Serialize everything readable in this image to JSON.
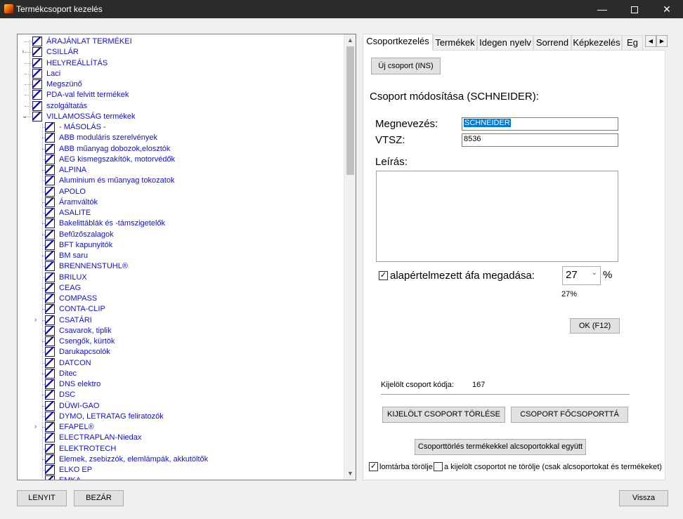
{
  "window": {
    "title": "Termékcsoport kezelés"
  },
  "tree": {
    "items": [
      {
        "label": "ÁRAJÁNLAT TERMÉKEI",
        "level": 0,
        "expander": ""
      },
      {
        "label": "CSILLÁR",
        "level": 0,
        "expander": ">"
      },
      {
        "label": "HELYREÁLLÍTÁS",
        "level": 0,
        "expander": ""
      },
      {
        "label": "Laci",
        "level": 0,
        "expander": ""
      },
      {
        "label": "Megszünő",
        "level": 0,
        "expander": ""
      },
      {
        "label": "PDA-val felvitt termékek",
        "level": 0,
        "expander": ""
      },
      {
        "label": "szolgáltatás",
        "level": 0,
        "expander": ""
      },
      {
        "label": "VILLAMOSSÁG termékek",
        "level": 0,
        "expander": "v"
      },
      {
        "label": " - MÁSOLÁS -",
        "level": 1,
        "expander": ""
      },
      {
        "label": "ABB moduláris szerelvények",
        "level": 1,
        "expander": ""
      },
      {
        "label": "ABB műanyag dobozok,elosztók",
        "level": 1,
        "expander": ""
      },
      {
        "label": "AEG kismegszakítók, motorvédők",
        "level": 1,
        "expander": ""
      },
      {
        "label": "ALPINA",
        "level": 1,
        "expander": ""
      },
      {
        "label": "Aluminium és műanyag tokozatok",
        "level": 1,
        "expander": ""
      },
      {
        "label": "APOLO",
        "level": 1,
        "expander": ""
      },
      {
        "label": "Áramváltók",
        "level": 1,
        "expander": ""
      },
      {
        "label": "ASALITE",
        "level": 1,
        "expander": ""
      },
      {
        "label": "Bakelittáblák és -támszigetelők",
        "level": 1,
        "expander": ""
      },
      {
        "label": "Befűzőszalagok",
        "level": 1,
        "expander": ""
      },
      {
        "label": "BFT kapunyitók",
        "level": 1,
        "expander": ""
      },
      {
        "label": "BM saru",
        "level": 1,
        "expander": ""
      },
      {
        "label": "BRENNENSTUHL®",
        "level": 1,
        "expander": ""
      },
      {
        "label": "BRILUX",
        "level": 1,
        "expander": ""
      },
      {
        "label": "CEAG",
        "level": 1,
        "expander": ""
      },
      {
        "label": "COMPASS",
        "level": 1,
        "expander": ""
      },
      {
        "label": "CONTA-CLIP",
        "level": 1,
        "expander": ""
      },
      {
        "label": "CSATÁRI",
        "level": 1,
        "expander": ">"
      },
      {
        "label": "Csavarok, tiplik",
        "level": 1,
        "expander": ""
      },
      {
        "label": "Csengők, kürtök",
        "level": 1,
        "expander": ""
      },
      {
        "label": "Darukapcsolók",
        "level": 1,
        "expander": ""
      },
      {
        "label": "DATCON",
        "level": 1,
        "expander": ""
      },
      {
        "label": "Ditec",
        "level": 1,
        "expander": ""
      },
      {
        "label": "DNS elektro",
        "level": 1,
        "expander": ""
      },
      {
        "label": "DSC",
        "level": 1,
        "expander": ""
      },
      {
        "label": "DÜWI-GAO",
        "level": 1,
        "expander": ""
      },
      {
        "label": "DYMO, LETRATAG feliratozók",
        "level": 1,
        "expander": ""
      },
      {
        "label": "EFAPEL®",
        "level": 1,
        "expander": ">"
      },
      {
        "label": "ELECTRAPLAN-Niedax",
        "level": 1,
        "expander": ""
      },
      {
        "label": "ELEKTROTECH",
        "level": 1,
        "expander": ""
      },
      {
        "label": "Elemek, zsebizzók, elemlámpák, akkutöltők",
        "level": 1,
        "expander": ""
      },
      {
        "label": "ELKO EP",
        "level": 1,
        "expander": ""
      },
      {
        "label": "EMKA",
        "level": 1,
        "expander": ""
      }
    ]
  },
  "tabs": [
    "Csoportkezelés",
    "Termékek",
    "Idegen nyelv",
    "Sorrend",
    "Képkezelés",
    "Eg"
  ],
  "panel": {
    "new_group_button": "Új csoport (INS)",
    "edit_heading": "Csoport módosítása (SCHNEIDER):",
    "name_label": "Megnevezés:",
    "name_value": "SCHNEIDER",
    "vtsz_label": "VTSZ:",
    "vtsz_value": "8536",
    "description_label": "Leírás:",
    "description_value": "",
    "vat_checkbox_label": "alapértelmezett áfa megadása:",
    "vat_checked": true,
    "vat_value": "27",
    "vat_unit": "%",
    "vat_display": "27%",
    "ok_button": "OK (F12)",
    "selected_code_label": "Kijelölt csoport kódja:",
    "selected_code_value": "167",
    "delete_button": "KIJELÖLT CSOPORT TÖRLÉSE",
    "promote_button": "CSOPORT FŐCSOPORTTÁ",
    "delete_with_products_button": "Csoporttörlés termékekkel alcsoportokkal együtt",
    "trash_checkbox_label": "lomtárba törölje",
    "trash_checked": true,
    "keep_checkbox_label": "a kijelölt csoportot ne törölje (csak alcsoportokat és termékeket)",
    "keep_checked": false
  },
  "footer": {
    "expand_button": "LENYIT",
    "collapse_button": "BEZÁR",
    "back_button": "Vissza"
  }
}
